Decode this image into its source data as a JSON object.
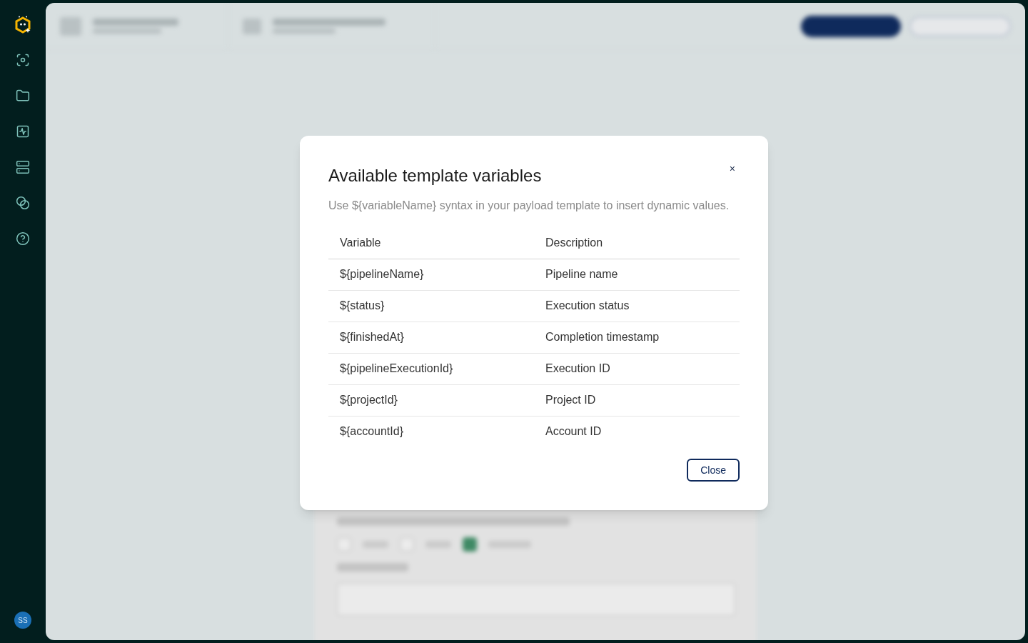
{
  "sidebar": {
    "avatar": "SS"
  },
  "background_form": {
    "checkboxes": [
      {
        "checked": false
      },
      {
        "checked": false
      },
      {
        "checked": true
      }
    ]
  },
  "dialog": {
    "title": "Available template variables",
    "close_glyph": "×",
    "description": "Use ${variableName} syntax in your payload template to insert dynamic values.",
    "table": {
      "columns": [
        "Variable",
        "Description"
      ],
      "rows": [
        [
          "${pipelineName}",
          "Pipeline name"
        ],
        [
          "${status}",
          "Execution status"
        ],
        [
          "${finishedAt}",
          "Completion timestamp"
        ],
        [
          "${pipelineExecutionId}",
          "Execution ID"
        ],
        [
          "${projectId}",
          "Project ID"
        ],
        [
          "${accountId}",
          "Account ID"
        ]
      ]
    },
    "buttons": [
      "Close"
    ]
  }
}
